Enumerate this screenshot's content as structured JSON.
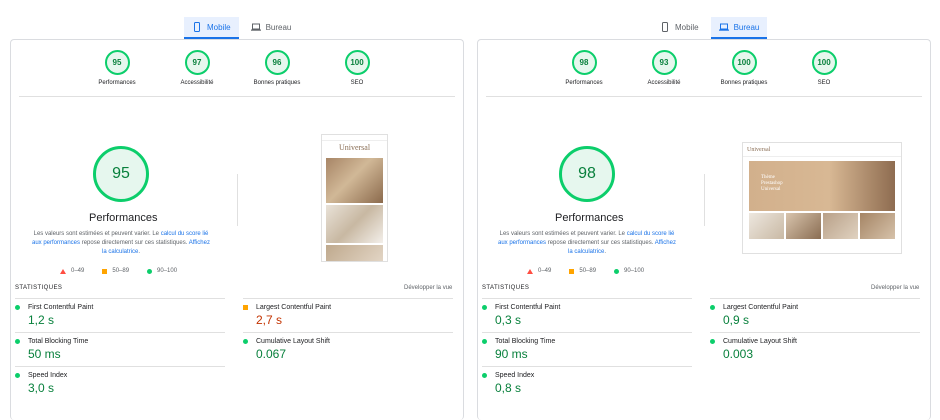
{
  "left": {
    "tabs": [
      {
        "label": "Mobile",
        "active": true
      },
      {
        "label": "Bureau",
        "active": false
      }
    ],
    "summary": [
      {
        "score": "95",
        "label": "Performances"
      },
      {
        "score": "97",
        "label": "Accessibilité"
      },
      {
        "score": "96",
        "label": "Bonnes pratiques"
      },
      {
        "score": "100",
        "label": "SEO"
      }
    ],
    "main_score": "95",
    "title": "Performances",
    "desc_before": "Les valeurs sont estimées et peuvent varier. Le ",
    "desc_link1": "calcul du score lié aux performances",
    "desc_middle": " repose directement sur ces statistiques. ",
    "desc_link2": "Affichez la calculatrice",
    "desc_after": ".",
    "legend": [
      "0–49",
      "50–89",
      "90–100"
    ],
    "stats_heading": "STATISTIQUES",
    "expand": "Développer la vue",
    "metrics": [
      {
        "name": "First Contentful Paint",
        "value": "1,2 s",
        "status": "good"
      },
      {
        "name": "Largest Contentful Paint",
        "value": "2,7 s",
        "status": "average"
      },
      {
        "name": "Total Blocking Time",
        "value": "50 ms",
        "status": "good"
      },
      {
        "name": "Cumulative Layout Shift",
        "value": "0.067",
        "status": "good"
      },
      {
        "name": "Speed Index",
        "value": "3,0 s",
        "status": "good"
      }
    ]
  },
  "right": {
    "tabs": [
      {
        "label": "Mobile",
        "active": false
      },
      {
        "label": "Bureau",
        "active": true
      }
    ],
    "summary": [
      {
        "score": "98",
        "label": "Performances"
      },
      {
        "score": "93",
        "label": "Accessibilité"
      },
      {
        "score": "100",
        "label": "Bonnes pratiques"
      },
      {
        "score": "100",
        "label": "SEO"
      }
    ],
    "main_score": "98",
    "title": "Performances",
    "desc_before": "Les valeurs sont estimées et peuvent varier. Le ",
    "desc_link1": "calcul du score lié aux performances",
    "desc_middle": " repose directement sur ces statistiques. ",
    "desc_link2": "Affichez la calculatrice",
    "desc_after": ".",
    "legend": [
      "0–49",
      "50–89",
      "90–100"
    ],
    "stats_heading": "STATISTIQUES",
    "expand": "Développer la vue",
    "metrics": [
      {
        "name": "First Contentful Paint",
        "value": "0,3 s",
        "status": "good"
      },
      {
        "name": "Largest Contentful Paint",
        "value": "0,9 s",
        "status": "good"
      },
      {
        "name": "Total Blocking Time",
        "value": "90 ms",
        "status": "good"
      },
      {
        "name": "Cumulative Layout Shift",
        "value": "0.003",
        "status": "good"
      },
      {
        "name": "Speed Index",
        "value": "0,8 s",
        "status": "good"
      }
    ],
    "thumbnail_heading": "Thème Prestashop Universal"
  },
  "thumbnail_logo": "Universal",
  "colors": {
    "good": "#0cce6b",
    "average": "#ffa400",
    "poor": "#ff4e42",
    "accent": "#1a73e8"
  }
}
